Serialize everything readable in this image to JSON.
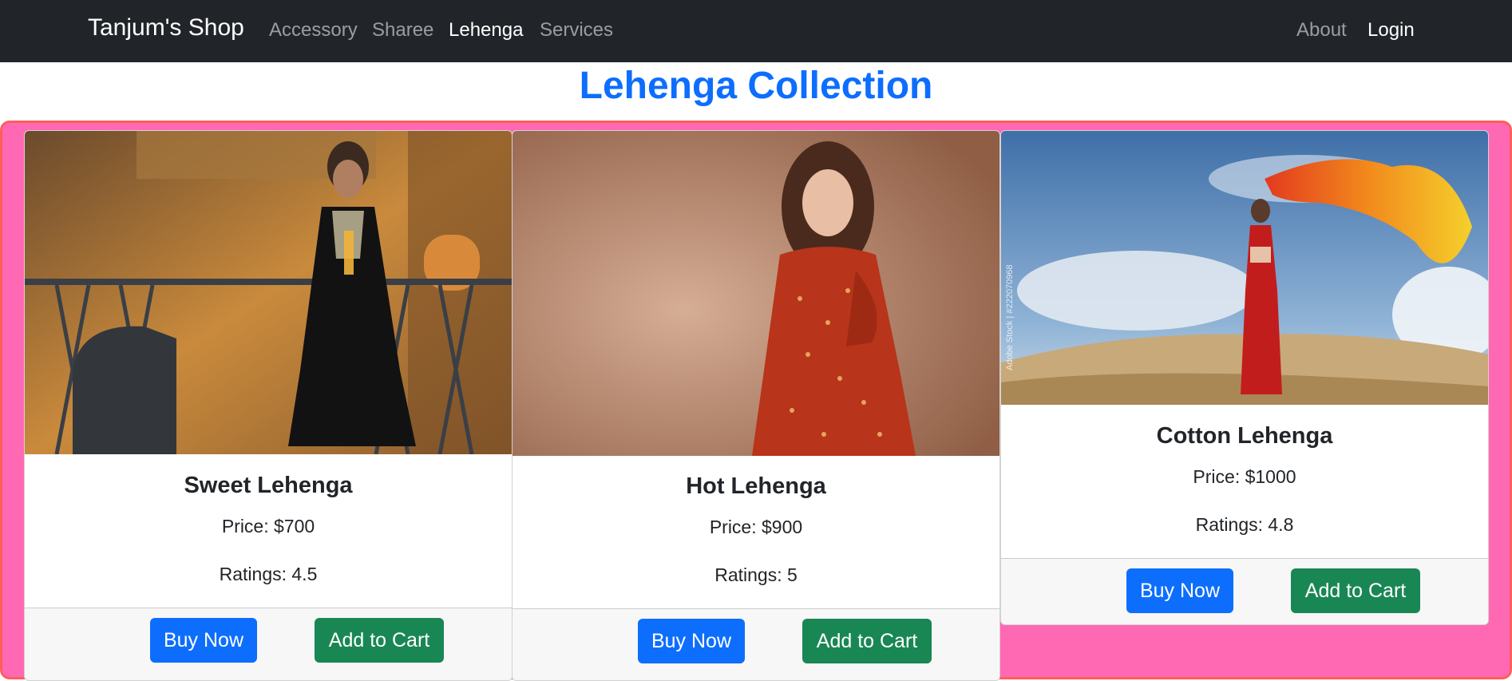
{
  "navbar": {
    "brand": "Tanjum's Shop",
    "links": [
      "Accessory",
      "Sharee",
      "Lehenga",
      "Services"
    ],
    "active_link": "Lehenga",
    "right_links": [
      "About",
      "Login"
    ]
  },
  "page": {
    "title": "Lehenga Collection"
  },
  "colors": {
    "accent": "#0d6efd",
    "success": "#198754",
    "panel": "#ff69b4",
    "navbar": "#212529"
  },
  "products": [
    {
      "title": "Sweet Lehenga",
      "price": "Price: $700",
      "ratings": "Ratings: 4.5",
      "buy_label": "Buy Now",
      "cart_label": "Add to Cart"
    },
    {
      "title": "Hot Lehenga",
      "price": "Price: $900",
      "ratings": "Ratings: 5",
      "buy_label": "Buy Now",
      "cart_label": "Add to Cart"
    },
    {
      "title": "Cotton Lehenga",
      "price": "Price: $1000",
      "ratings": "Ratings: 4.8",
      "buy_label": "Buy Now",
      "cart_label": "Add to Cart"
    }
  ],
  "images": {
    "watermark": "Adobe Stock | #222070968"
  }
}
